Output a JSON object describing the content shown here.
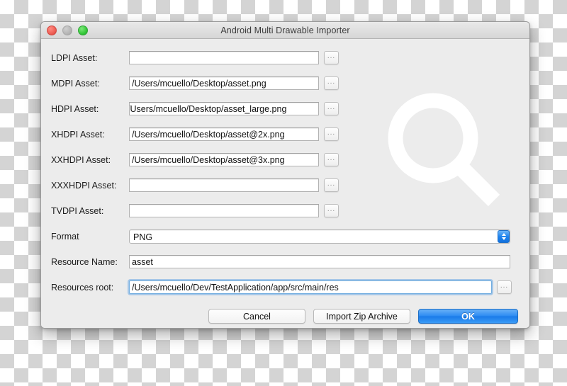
{
  "window": {
    "title": "Android Multi Drawable Importer",
    "traffic_lights": [
      "close-button",
      "minimize-button",
      "zoom-button"
    ]
  },
  "watermark": {
    "icon": "magnifier-icon",
    "color": "#ffffff"
  },
  "form": {
    "browse_label": "...",
    "rows": [
      {
        "label": "LDPI Asset:",
        "value": "",
        "name": "ldpi"
      },
      {
        "label": "MDPI Asset:",
        "value": "/Users/mcuello/Desktop/asset.png",
        "name": "mdpi"
      },
      {
        "label": "HDPI Asset:",
        "value": "/Users/mcuello/Desktop/asset_large.png",
        "name": "hdpi"
      },
      {
        "label": "XHDPI Asset:",
        "value": "/Users/mcuello/Desktop/asset@2x.png",
        "name": "xhdpi"
      },
      {
        "label": "XXHDPI Asset:",
        "value": "/Users/mcuello/Desktop/asset@3x.png",
        "name": "xxhdpi"
      },
      {
        "label": "XXXHDPI Asset:",
        "value": "",
        "name": "xxxhdpi"
      },
      {
        "label": "TVDPI Asset:",
        "value": "",
        "name": "tvdpi"
      }
    ],
    "format": {
      "label": "Format",
      "value": "PNG",
      "options": [
        "PNG"
      ]
    },
    "resource_name": {
      "label": "Resource Name:",
      "value": "asset"
    },
    "resources_root": {
      "label": "Resources root:",
      "value": "/Users/mcuello/Dev/TestApplication/app/src/main/res",
      "focused": true
    }
  },
  "buttons": {
    "cancel": "Cancel",
    "import_zip": "Import Zip Archive",
    "ok": "OK",
    "ok_color": "#2d8bf2"
  }
}
